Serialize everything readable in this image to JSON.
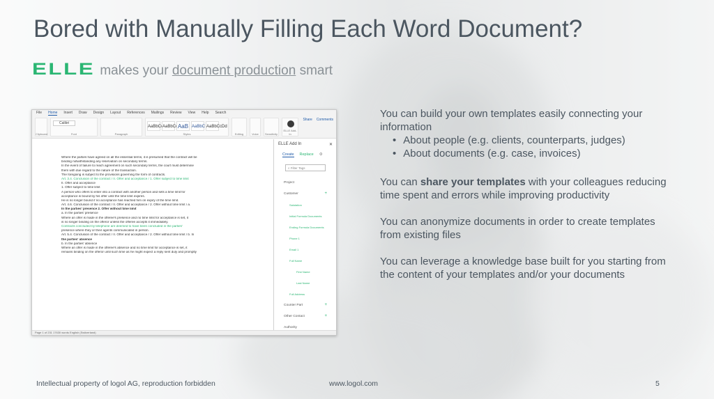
{
  "slide": {
    "title": "Bored with Manually Filling Each Word Document?",
    "logo_text": "ELLE",
    "tagline_pre": "makes your",
    "tagline_link": "document production",
    "tagline_post": "smart",
    "accent_color": "#2bb673",
    "text_color": "#4b5660"
  },
  "word_window": {
    "menu_items": [
      "File",
      "Home",
      "Insert",
      "Draw",
      "Design",
      "Layout",
      "References",
      "Mailings",
      "Review",
      "View",
      "Help",
      "Search"
    ],
    "share_label": "Share",
    "comments_label": "Comments",
    "ribbon_groups": [
      "Clipboard",
      "Font",
      "Paragraph",
      "Styles",
      "Editing",
      "Voice",
      "Sensitivity",
      "ELLE Add-In"
    ],
    "styles": [
      "AaBbCcDc",
      "AaBbCcDc",
      "AaB",
      "AaBbC",
      "AaBbCcDd"
    ],
    "style_names": [
      "Normal",
      "No Spac...",
      "Heading 1",
      "Heading 2",
      "Heading 3"
    ],
    "font_name": "Calibri",
    "doc_lines": [
      {
        "text": "Where the parties have agreed on all the essential terms, it is presumed that the contract will be",
        "style": ""
      },
      {
        "text": "binding notwithstanding any reservation on secondary terms.",
        "style": ""
      },
      {
        "text": "In the event of failure to reach agreement on such secondary terms, the court must determine",
        "style": ""
      },
      {
        "text": "them with due regard to the nature of the transaction.",
        "style": ""
      },
      {
        "text": "The foregoing is subject to the provisions governing the form of contracts.",
        "style": ""
      },
      {
        "text": "Art. 3.4. Conclusion of the contract / II. Offer and acceptance / 1. Offer subject to time limit",
        "style": "green"
      },
      {
        "text": "II. Offer and acceptance",
        "style": ""
      },
      {
        "text": "1. Offer subject to time limit",
        "style": ""
      },
      {
        "text": "A person who offers to enter into a contract with another person and sets a time limit for",
        "style": ""
      },
      {
        "text": "acceptance is bound by his offer until the time limit expires.",
        "style": ""
      },
      {
        "text": "He is no longer bound if no acceptance has reached him on expiry of the time limit.",
        "style": ""
      },
      {
        "text": "Art. 4.6. Conclusion of the contract / II. Offer and acceptance / 2. Offer without time limit / a.",
        "style": ""
      },
      {
        "text": "In the parties' presence 2. Offer without time limit",
        "style": "bold"
      },
      {
        "text": "a. In the parties' presence",
        "style": ""
      },
      {
        "text": "Where an offer is made in the offeree's presence and no time limit for acceptance is set, it",
        "style": ""
      },
      {
        "text": "is no longer binding on the offeror unless the offeree accepts it immediately.",
        "style": ""
      },
      {
        "text": "Contracts concluded by telephone are deemed to have been concluded in the parties'",
        "style": "green"
      },
      {
        "text": "presence where they or their agents communicated in person.",
        "style": ""
      },
      {
        "text": "Art. 5.4. Conclusion of the contract / II. Offer and acceptance / 2. Offer without time limit / b. In",
        "style": ""
      },
      {
        "text": "the parties' absence",
        "style": "bold"
      },
      {
        "text": "b. In the parties' absence",
        "style": ""
      },
      {
        "text": "Where an offer is made in the offeree's absence and no time limit for acceptance is set, it",
        "style": ""
      },
      {
        "text": "remains binding on the offeror until such time as he might expect a reply sent duly and promptly",
        "style": ""
      }
    ],
    "status_text": "Page 1 of 231   17630 words   English (Switzerland)",
    "addin": {
      "title": "ELLE Add In",
      "tab_create": "Create",
      "tab_replace": "Replace",
      "filter_placeholder": "Filter Tags",
      "tree": [
        {
          "label": "Project",
          "level": 0,
          "plus": false
        },
        {
          "label": "Customer",
          "level": 0,
          "plus": true
        },
        {
          "label": "Salutation",
          "level": 1,
          "plus": false
        },
        {
          "label": "Initial Formula Documents",
          "level": 1,
          "plus": false
        },
        {
          "label": "Ending Formula Documents",
          "level": 1,
          "plus": false
        },
        {
          "label": "Phone 1",
          "level": 1,
          "plus": false
        },
        {
          "label": "Email 1",
          "level": 1,
          "plus": false
        },
        {
          "label": "Full Name",
          "level": 1,
          "plus": false
        },
        {
          "label": "First Name",
          "level": 2,
          "plus": false
        },
        {
          "label": "Last Name",
          "level": 2,
          "plus": false
        },
        {
          "label": "Full Address",
          "level": 1,
          "plus": false
        },
        {
          "label": "Counter Part",
          "level": 0,
          "plus": true
        },
        {
          "label": "Other Contact",
          "level": 0,
          "plus": true
        },
        {
          "label": "Authority",
          "level": 0,
          "plus": false
        }
      ]
    }
  },
  "content": {
    "p1": "You can build your own templates easily connecting your information",
    "bullets": [
      "About people (e.g. clients, counterparts, judges)",
      "About documents (e.g. case, invoices)"
    ],
    "p2_pre": "You can",
    "p2_bold": "share your templates",
    "p2_post": "with your colleagues reducing time spent and errors while improving productivity",
    "p3": "You can anonymize documents in order to create templates from existing files",
    "p4": "You can leverage a knowledge base built for you starting from the content of your templates and/or your documents"
  },
  "footer": {
    "left": "Intellectual property of logol AG, reproduction forbidden",
    "center": "www.logol.com",
    "page_number": "5"
  }
}
